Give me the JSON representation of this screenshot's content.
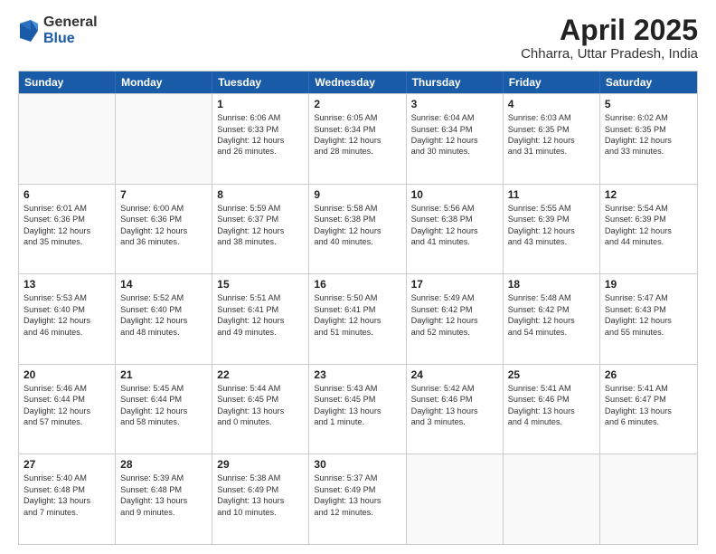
{
  "header": {
    "logo_general": "General",
    "logo_blue": "Blue",
    "month_title": "April 2025",
    "subtitle": "Chharra, Uttar Pradesh, India"
  },
  "weekdays": [
    "Sunday",
    "Monday",
    "Tuesday",
    "Wednesday",
    "Thursday",
    "Friday",
    "Saturday"
  ],
  "rows": [
    [
      {
        "day": "",
        "lines": [],
        "empty": true
      },
      {
        "day": "",
        "lines": [],
        "empty": true
      },
      {
        "day": "1",
        "lines": [
          "Sunrise: 6:06 AM",
          "Sunset: 6:33 PM",
          "Daylight: 12 hours",
          "and 26 minutes."
        ]
      },
      {
        "day": "2",
        "lines": [
          "Sunrise: 6:05 AM",
          "Sunset: 6:34 PM",
          "Daylight: 12 hours",
          "and 28 minutes."
        ]
      },
      {
        "day": "3",
        "lines": [
          "Sunrise: 6:04 AM",
          "Sunset: 6:34 PM",
          "Daylight: 12 hours",
          "and 30 minutes."
        ]
      },
      {
        "day": "4",
        "lines": [
          "Sunrise: 6:03 AM",
          "Sunset: 6:35 PM",
          "Daylight: 12 hours",
          "and 31 minutes."
        ]
      },
      {
        "day": "5",
        "lines": [
          "Sunrise: 6:02 AM",
          "Sunset: 6:35 PM",
          "Daylight: 12 hours",
          "and 33 minutes."
        ]
      }
    ],
    [
      {
        "day": "6",
        "lines": [
          "Sunrise: 6:01 AM",
          "Sunset: 6:36 PM",
          "Daylight: 12 hours",
          "and 35 minutes."
        ]
      },
      {
        "day": "7",
        "lines": [
          "Sunrise: 6:00 AM",
          "Sunset: 6:36 PM",
          "Daylight: 12 hours",
          "and 36 minutes."
        ]
      },
      {
        "day": "8",
        "lines": [
          "Sunrise: 5:59 AM",
          "Sunset: 6:37 PM",
          "Daylight: 12 hours",
          "and 38 minutes."
        ]
      },
      {
        "day": "9",
        "lines": [
          "Sunrise: 5:58 AM",
          "Sunset: 6:38 PM",
          "Daylight: 12 hours",
          "and 40 minutes."
        ]
      },
      {
        "day": "10",
        "lines": [
          "Sunrise: 5:56 AM",
          "Sunset: 6:38 PM",
          "Daylight: 12 hours",
          "and 41 minutes."
        ]
      },
      {
        "day": "11",
        "lines": [
          "Sunrise: 5:55 AM",
          "Sunset: 6:39 PM",
          "Daylight: 12 hours",
          "and 43 minutes."
        ]
      },
      {
        "day": "12",
        "lines": [
          "Sunrise: 5:54 AM",
          "Sunset: 6:39 PM",
          "Daylight: 12 hours",
          "and 44 minutes."
        ]
      }
    ],
    [
      {
        "day": "13",
        "lines": [
          "Sunrise: 5:53 AM",
          "Sunset: 6:40 PM",
          "Daylight: 12 hours",
          "and 46 minutes."
        ]
      },
      {
        "day": "14",
        "lines": [
          "Sunrise: 5:52 AM",
          "Sunset: 6:40 PM",
          "Daylight: 12 hours",
          "and 48 minutes."
        ]
      },
      {
        "day": "15",
        "lines": [
          "Sunrise: 5:51 AM",
          "Sunset: 6:41 PM",
          "Daylight: 12 hours",
          "and 49 minutes."
        ]
      },
      {
        "day": "16",
        "lines": [
          "Sunrise: 5:50 AM",
          "Sunset: 6:41 PM",
          "Daylight: 12 hours",
          "and 51 minutes."
        ]
      },
      {
        "day": "17",
        "lines": [
          "Sunrise: 5:49 AM",
          "Sunset: 6:42 PM",
          "Daylight: 12 hours",
          "and 52 minutes."
        ]
      },
      {
        "day": "18",
        "lines": [
          "Sunrise: 5:48 AM",
          "Sunset: 6:42 PM",
          "Daylight: 12 hours",
          "and 54 minutes."
        ]
      },
      {
        "day": "19",
        "lines": [
          "Sunrise: 5:47 AM",
          "Sunset: 6:43 PM",
          "Daylight: 12 hours",
          "and 55 minutes."
        ]
      }
    ],
    [
      {
        "day": "20",
        "lines": [
          "Sunrise: 5:46 AM",
          "Sunset: 6:44 PM",
          "Daylight: 12 hours",
          "and 57 minutes."
        ]
      },
      {
        "day": "21",
        "lines": [
          "Sunrise: 5:45 AM",
          "Sunset: 6:44 PM",
          "Daylight: 12 hours",
          "and 58 minutes."
        ]
      },
      {
        "day": "22",
        "lines": [
          "Sunrise: 5:44 AM",
          "Sunset: 6:45 PM",
          "Daylight: 13 hours",
          "and 0 minutes."
        ]
      },
      {
        "day": "23",
        "lines": [
          "Sunrise: 5:43 AM",
          "Sunset: 6:45 PM",
          "Daylight: 13 hours",
          "and 1 minute."
        ]
      },
      {
        "day": "24",
        "lines": [
          "Sunrise: 5:42 AM",
          "Sunset: 6:46 PM",
          "Daylight: 13 hours",
          "and 3 minutes."
        ]
      },
      {
        "day": "25",
        "lines": [
          "Sunrise: 5:41 AM",
          "Sunset: 6:46 PM",
          "Daylight: 13 hours",
          "and 4 minutes."
        ]
      },
      {
        "day": "26",
        "lines": [
          "Sunrise: 5:41 AM",
          "Sunset: 6:47 PM",
          "Daylight: 13 hours",
          "and 6 minutes."
        ]
      }
    ],
    [
      {
        "day": "27",
        "lines": [
          "Sunrise: 5:40 AM",
          "Sunset: 6:48 PM",
          "Daylight: 13 hours",
          "and 7 minutes."
        ]
      },
      {
        "day": "28",
        "lines": [
          "Sunrise: 5:39 AM",
          "Sunset: 6:48 PM",
          "Daylight: 13 hours",
          "and 9 minutes."
        ]
      },
      {
        "day": "29",
        "lines": [
          "Sunrise: 5:38 AM",
          "Sunset: 6:49 PM",
          "Daylight: 13 hours",
          "and 10 minutes."
        ]
      },
      {
        "day": "30",
        "lines": [
          "Sunrise: 5:37 AM",
          "Sunset: 6:49 PM",
          "Daylight: 13 hours",
          "and 12 minutes."
        ]
      },
      {
        "day": "",
        "lines": [],
        "empty": true
      },
      {
        "day": "",
        "lines": [],
        "empty": true
      },
      {
        "day": "",
        "lines": [],
        "empty": true
      }
    ]
  ]
}
